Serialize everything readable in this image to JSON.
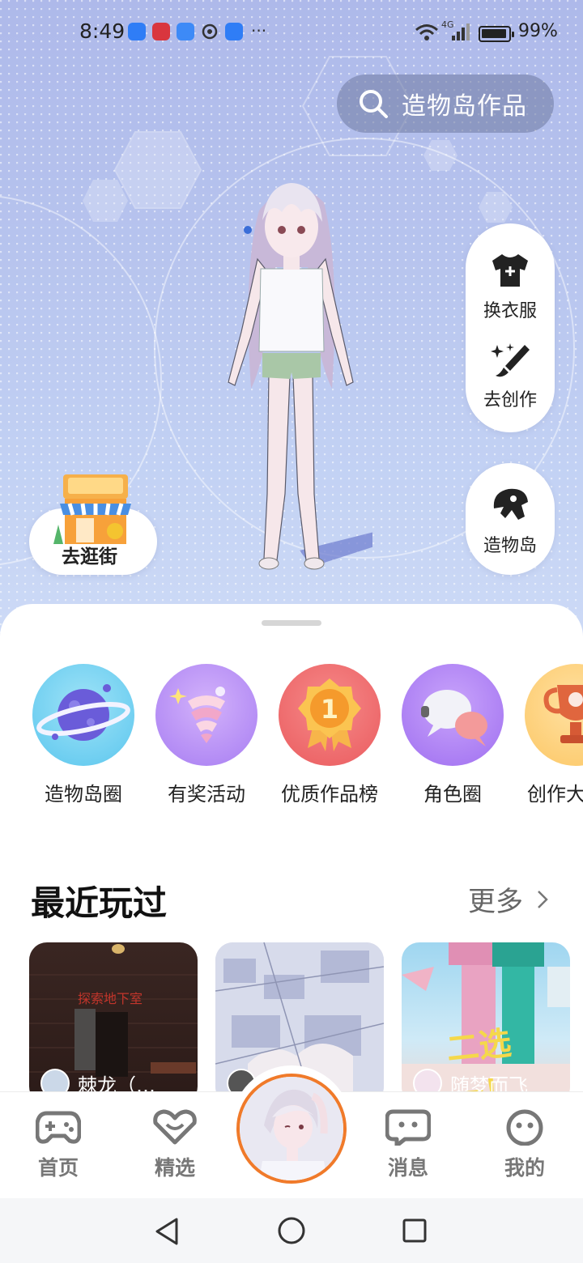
{
  "status_bar": {
    "time": "8:49",
    "overflow": "···",
    "network": "4G",
    "battery_percent": "99%"
  },
  "search": {
    "placeholder": "造物岛作品"
  },
  "float_actions": {
    "change_clothes": "换衣服",
    "go_create": "去创作",
    "creation_island": "造物岛"
  },
  "shop": {
    "label": "去逛街"
  },
  "categories": [
    {
      "label": "造物岛圈",
      "icon": "planet-icon"
    },
    {
      "label": "有奖活动",
      "icon": "gift-swirl-icon"
    },
    {
      "label": "优质作品榜",
      "icon": "medal-icon"
    },
    {
      "label": "角色圈",
      "icon": "chat-bubble-icon"
    },
    {
      "label": "创作大赛榜",
      "icon": "trophy-icon"
    }
  ],
  "recent": {
    "title": "最近玩过",
    "more": "更多",
    "cards": [
      {
        "user": "棘龙（…",
        "sign": "探索地下室"
      },
      {
        "user": "",
        "sign": ""
      },
      {
        "user": "随梦而飞",
        "sign": "二选一！"
      }
    ]
  },
  "tabs": {
    "home": "首页",
    "featured": "精选",
    "messages": "消息",
    "mine": "我的"
  },
  "colors": {
    "accent_orange": "#f07a2a",
    "tab_gray": "#777777"
  }
}
